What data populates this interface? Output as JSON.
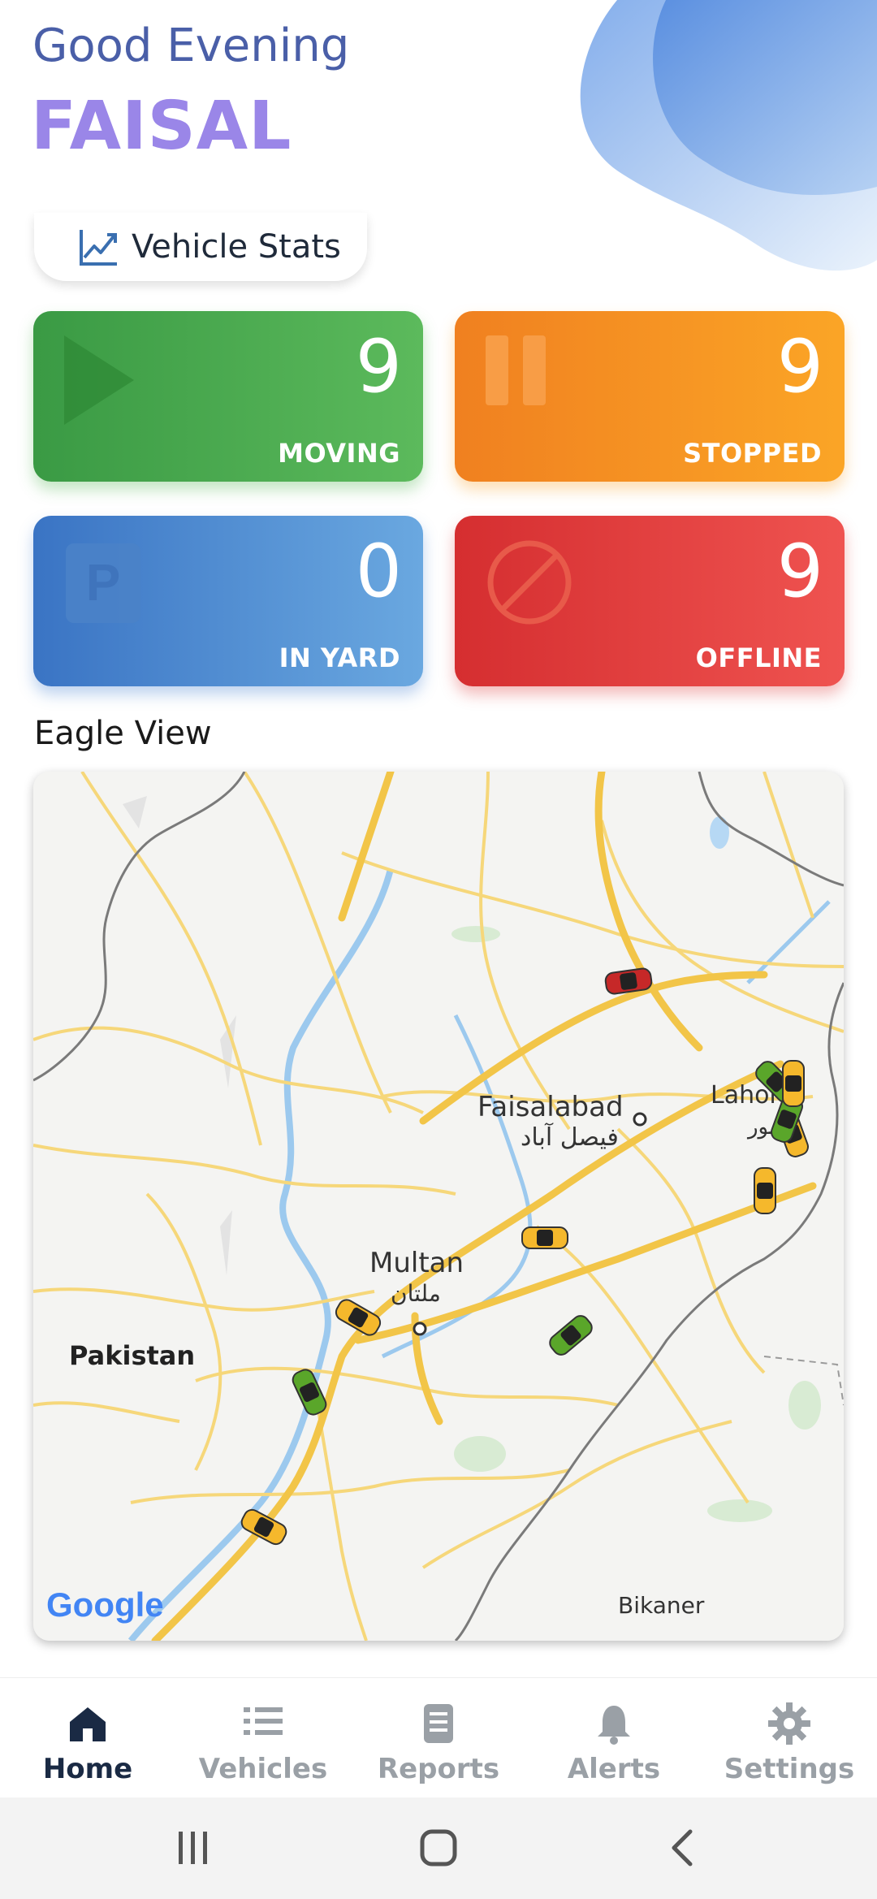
{
  "header": {
    "greeting": "Good Evening",
    "user_name": "FAISAL"
  },
  "vehicle_stats_button": {
    "label": "Vehicle Stats",
    "icon": "trend-chart-icon"
  },
  "status_cards": [
    {
      "key": "moving",
      "count": "9",
      "label": "MOVING",
      "icon": "play-icon",
      "color": "#4caf50"
    },
    {
      "key": "stopped",
      "count": "9",
      "label": "STOPPED",
      "icon": "pause-icon",
      "color": "#f7931e"
    },
    {
      "key": "in_yard",
      "count": "0",
      "label": "IN YARD",
      "icon": "parking-icon",
      "color": "#4a8ad4"
    },
    {
      "key": "offline",
      "count": "9",
      "label": "OFFLINE",
      "icon": "block-icon",
      "color": "#e53935"
    }
  ],
  "eagle_view": {
    "title": "Eagle View",
    "map_labels": {
      "faisalabad": "Faisalabad",
      "faisalabad_urdu": "فیصل آباد",
      "lahore": "Lahore",
      "lahore_urdu": "لاہور",
      "multan": "Multan",
      "multan_urdu": "ملتان",
      "pakistan": "Pakistan",
      "bikaner": "Bikaner"
    },
    "attribution": "Google"
  },
  "bottom_nav": [
    {
      "label": "Home",
      "icon": "home-icon",
      "active": true
    },
    {
      "label": "Vehicles",
      "icon": "list-icon",
      "active": false
    },
    {
      "label": "Reports",
      "icon": "report-icon",
      "active": false
    },
    {
      "label": "Alerts",
      "icon": "bell-icon",
      "active": false
    },
    {
      "label": "Settings",
      "icon": "gear-icon",
      "active": false
    }
  ],
  "system_nav": {
    "recent": "recent-apps-icon",
    "home": "system-home-icon",
    "back": "back-icon"
  }
}
